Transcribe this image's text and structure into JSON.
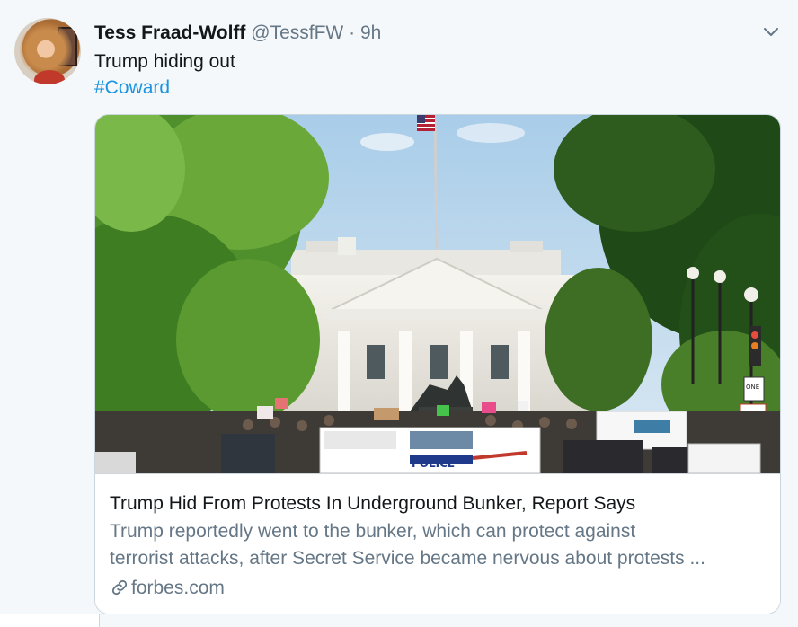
{
  "tweet": {
    "author_name": "Tess Fraad-Wolff",
    "author_handle": "@TessfFW",
    "separator": "·",
    "time": "9h",
    "text": "Trump hiding out",
    "hashtag": "#Coward",
    "menu_icon": "chevron-down-icon"
  },
  "card": {
    "title": "Trump Hid From Protests In Underground Bunker, Report Says",
    "description_line1": "Trump reportedly went to the bunker, which can protect against",
    "description_line2": "terrorist attacks, after Secret Service became nervous about protests ...",
    "domain": "forbes.com",
    "domain_icon": "link-icon",
    "image_police_label": "POLICE",
    "image_sign_label": "ONE"
  },
  "footer_fragment": "",
  "colors": {
    "accent": "#1b95e0",
    "text": "#14171a",
    "secondary": "#657786",
    "border": "#ccd6dd",
    "background": "#f5f8fa"
  }
}
